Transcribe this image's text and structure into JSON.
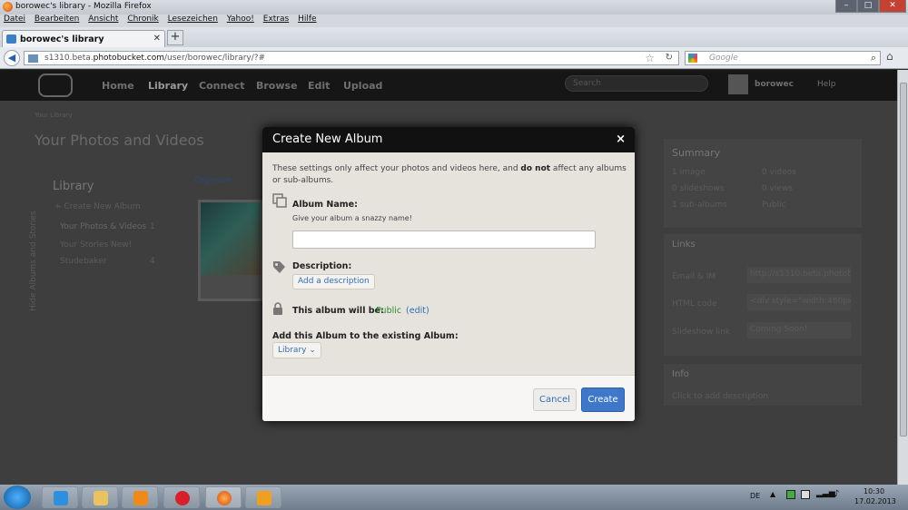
{
  "window": {
    "title": "borowec's library - Mozilla Firefox"
  },
  "menu": [
    "Datei",
    "Bearbeiten",
    "Ansicht",
    "Chronik",
    "Lesezeichen",
    "Yahoo!",
    "Extras",
    "Hilfe"
  ],
  "tab": {
    "label": "borowec's library"
  },
  "url": {
    "prefix": "s1310.beta.",
    "domain": "photobucket.com",
    "path": "/user/borowec/library/?#"
  },
  "search": {
    "placeholder": "Google"
  },
  "pbnav": {
    "items": [
      "Home",
      "Library",
      "Connect",
      "Browse",
      "Edit",
      "Upload"
    ],
    "search": "Search",
    "user": "borowec",
    "help": "Help"
  },
  "background": {
    "crumb": "Your Library",
    "heading": "Your Photos and Videos",
    "side": {
      "title": "Library",
      "create": "+ Create New Album",
      "items": [
        {
          "label": "Your Photos & Videos",
          "count": "1"
        },
        {
          "label": "Your Stories",
          "badge": "New!"
        },
        {
          "label": "Studebaker",
          "count": "4"
        }
      ],
      "vertical": "Hide Albums and Stories"
    },
    "organize": "Organize",
    "summary": {
      "title": "Summary",
      "items": [
        "1 image",
        "0 videos",
        "0 slideshows",
        "0 views",
        "1 sub-albums",
        "Public"
      ]
    },
    "links": {
      "title": "Links",
      "rows": [
        {
          "k": "Email & IM",
          "v": "http://s1310.beta.photobuc"
        },
        {
          "k": "HTML code",
          "v": "<div style=\"width:480px;text"
        },
        {
          "k": "Slideshow link",
          "v": "Coming Soon!"
        }
      ]
    },
    "info": {
      "title": "Info",
      "text": "Click to add description"
    }
  },
  "modal": {
    "title": "Create New Album",
    "close": "×",
    "intro_a": "These settings only affect your photos and videos here, and ",
    "intro_b": "do not",
    "intro_c": " affect any albums or sub-albums.",
    "name_label": "Album Name:",
    "name_hint": "Give your album a snazzy name!",
    "name_value": "",
    "desc_label": "Description:",
    "desc_btn": "Add a description",
    "privacy_label": "This album will be:",
    "privacy_value": "Public",
    "privacy_edit": "edit",
    "parent_label": "Add this Album to the existing Album:",
    "parent_value": "Library",
    "cancel": "Cancel",
    "create": "Create"
  },
  "taskbar": {
    "lang": "DE",
    "time": "10:30",
    "date": "17.02.2013"
  },
  "colors": {
    "accent": "#3f78c8",
    "public": "#2e8b2e",
    "link": "#2f6db5"
  }
}
